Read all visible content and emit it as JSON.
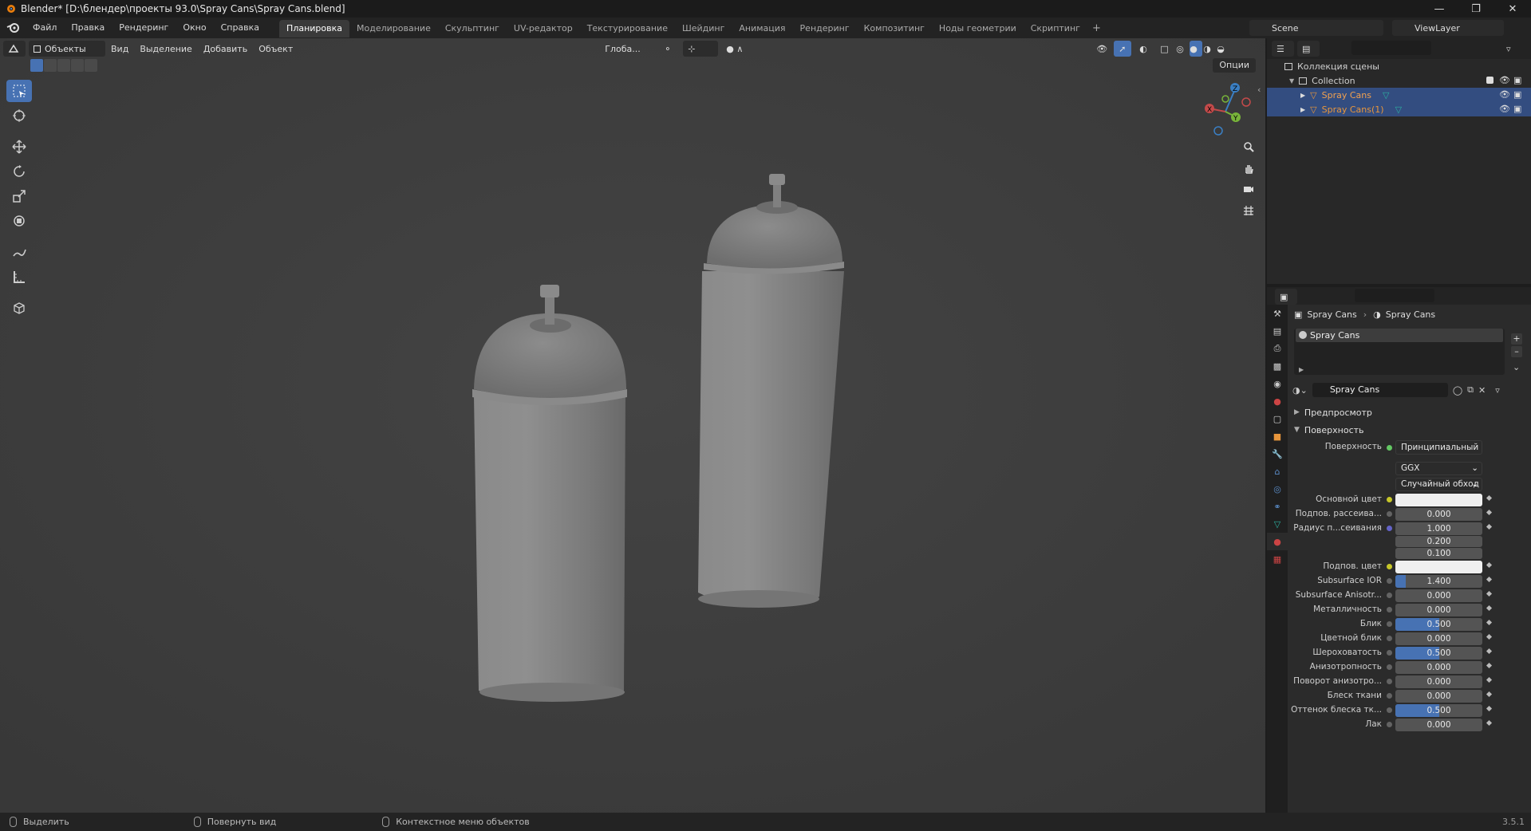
{
  "window": {
    "title": "Blender* [D:\\блендер\\проекты 93.0\\Spray Cans\\Spray Cans.blend]"
  },
  "menu": [
    "Файл",
    "Правка",
    "Рендеринг",
    "Окно",
    "Справка"
  ],
  "workspaces": [
    "Планировка",
    "Моделирование",
    "Скульптинг",
    "UV-редактор",
    "Текстурирование",
    "Шейдинг",
    "Анимация",
    "Рендеринг",
    "Композитинг",
    "Ноды геометрии",
    "Скриптинг"
  ],
  "active_workspace_index": 0,
  "scene": "Scene",
  "view_layer": "ViewLayer",
  "viewport": {
    "mode": "Объекты",
    "menus": [
      "Вид",
      "Выделение",
      "Добавить",
      "Объект"
    ],
    "orientation": "Глоба...",
    "options": "Опции"
  },
  "outliner": {
    "scene_collection": "Коллекция сцены",
    "collection": "Collection",
    "objects": [
      "Spray Cans",
      "Spray Cans(1)"
    ]
  },
  "properties": {
    "breadcrumb": [
      "Spray Cans",
      "Spray Cans"
    ],
    "slot": "Spray Cans",
    "material_name": "Spray Cans",
    "sections": {
      "preview": "Предпросмотр",
      "surface": "Поверхность"
    },
    "surface_label": "Поверхность",
    "surface_shader": "Принципиальный BSDF",
    "distribution": "GGX",
    "subsurface_method": "Случайный обход",
    "rows": [
      {
        "label": "Основной цвет",
        "type": "color",
        "color": "#f0f0f0",
        "dot": "yellow"
      },
      {
        "label": "Подпов. рассеива...",
        "value": "0.000",
        "dot": "grey"
      },
      {
        "label": "Радиус п...сеивания",
        "value": "1.000",
        "dot": "purple"
      },
      {
        "label": "",
        "value": "0.200"
      },
      {
        "label": "",
        "value": "0.100"
      },
      {
        "label": "Подпов. цвет",
        "type": "color",
        "color": "#f0f0f0",
        "dot": "yellow"
      },
      {
        "label": "Subsurface IOR",
        "value": "1.400",
        "dot": "grey",
        "fill": 0.12
      },
      {
        "label": "Subsurface Anisotr...",
        "value": "0.000",
        "dot": "grey"
      },
      {
        "label": "Металличность",
        "value": "0.000",
        "dot": "grey"
      },
      {
        "label": "Блик",
        "value": "0.500",
        "dot": "grey",
        "fill": 0.5
      },
      {
        "label": "Цветной блик",
        "value": "0.000",
        "dot": "grey"
      },
      {
        "label": "Шероховатость",
        "value": "0.500",
        "dot": "grey",
        "fill": 0.5
      },
      {
        "label": "Анизотропность",
        "value": "0.000",
        "dot": "grey"
      },
      {
        "label": "Поворот анизотро...",
        "value": "0.000",
        "dot": "grey"
      },
      {
        "label": "Блеск ткани",
        "value": "0.000",
        "dot": "grey"
      },
      {
        "label": "Оттенок блеска тк...",
        "value": "0.500",
        "dot": "grey",
        "fill": 0.5
      },
      {
        "label": "Лак",
        "value": "0.000",
        "dot": "grey"
      }
    ]
  },
  "status": {
    "select": "Выделить",
    "rotate": "Повернуть вид",
    "context": "Контекстное меню объектов",
    "version": "3.5.1"
  },
  "colors": {
    "accent": "#4772b3",
    "selected_row": "#334d80",
    "object_orange": "#e8963c"
  }
}
